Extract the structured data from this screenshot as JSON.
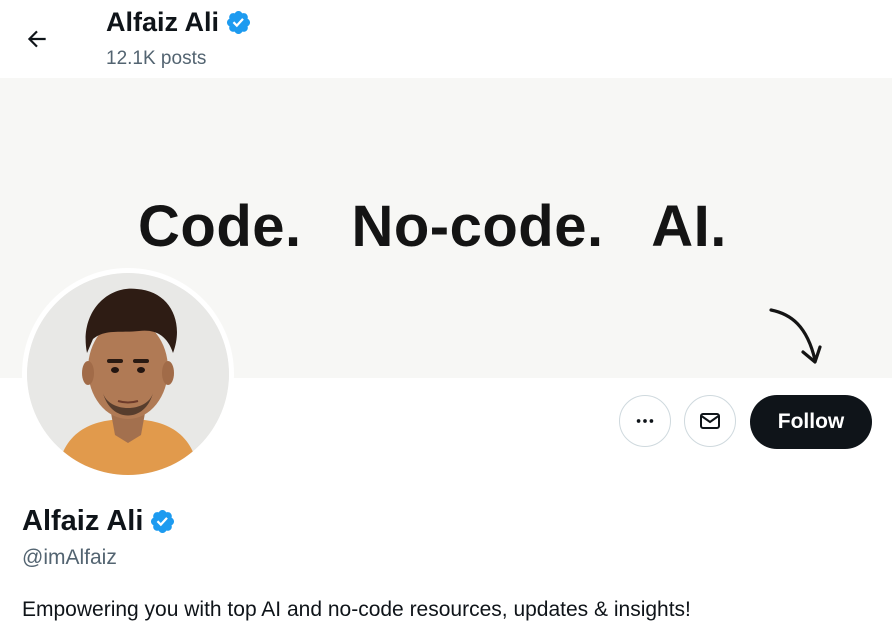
{
  "header": {
    "name": "Alfaiz Ali",
    "posts": "12.1K posts"
  },
  "banner": {
    "tagline": "Code.   No-code.   AI."
  },
  "actions": {
    "follow_label": "Follow"
  },
  "profile": {
    "name": "Alfaiz Ali",
    "handle": "@imAlfaiz",
    "bio": "Empowering you with top AI and no-code resources, updates & insights!"
  },
  "icons": {
    "back": "arrow-left-icon",
    "verified": "verified-badge-icon",
    "more": "more-dots-icon",
    "message": "envelope-icon",
    "banner_arrow": "curved-arrow-icon"
  },
  "colors": {
    "verified": "#1d9bf0",
    "follow_bg": "#0f1419",
    "secondary_text": "#536471",
    "banner_bg": "#f7f7f5",
    "border": "#cfd9de"
  }
}
